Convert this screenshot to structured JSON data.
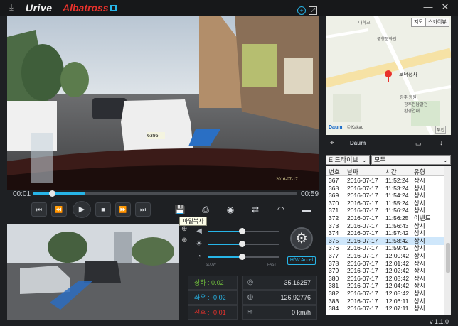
{
  "app": {
    "name_part1": "Urive",
    "name_part2": "Albatross",
    "version": "v 1.1.0"
  },
  "window": {
    "minimize": "—",
    "close": "✕",
    "download": "⤓"
  },
  "video": {
    "main_label": "dashcam-front-view",
    "overlay_icons": [
      "zoom-icon",
      "expand-icon"
    ],
    "sub_label": "dashcam-rear-view",
    "plate_text": "6395",
    "timestamp_overlay": "2016-07-17"
  },
  "player": {
    "time_current": "00:01",
    "time_total": "00:59",
    "progress": 0.04,
    "controls": [
      "first-icon",
      "rewind-icon",
      "play-icon",
      "stop-icon",
      "fast-forward-icon",
      "last-icon"
    ],
    "tools": [
      "save-icon",
      "print-icon",
      "camera-icon",
      "swap-icon",
      "speed-icon",
      "car-icon"
    ],
    "tooltip": "파일복사"
  },
  "adjust": {
    "volume": 0.48,
    "brightness": 0.48,
    "speed": 0.48,
    "slow_label": "SLOW",
    "fast_label": "FAST",
    "hwaccel": "H/W Accel"
  },
  "sensors": {
    "updown_label": "상하 : 0.02",
    "leftright_label": "좌우 : -0.02",
    "frontback_label": "전후 : -0.01",
    "latitude": "35.16257",
    "longitude": "126.92776",
    "speed": "0 km/h"
  },
  "map": {
    "tab_map": "지도",
    "tab_skyview": "스카이뷰",
    "label_univ": "대학교",
    "label_school": "풍향문화관",
    "label_temple": "보덕정사",
    "label_office": "광주 동원",
    "label_env": "광주전남발전\n환경연대",
    "scale": "두럽",
    "attribution": "© Kakao",
    "logo": "Daum",
    "provider": "Daum"
  },
  "list": {
    "drive_select": "E 드라이브",
    "type_select": "모두",
    "columns": [
      "번호",
      "날짜",
      "시간",
      "유형"
    ],
    "rows": [
      [
        "367",
        "2016-07-17",
        "11:52:24",
        "상시"
      ],
      [
        "368",
        "2016-07-17",
        "11:53:24",
        "상시"
      ],
      [
        "369",
        "2016-07-17",
        "11:54:24",
        "상시"
      ],
      [
        "370",
        "2016-07-17",
        "11:55:24",
        "상시"
      ],
      [
        "371",
        "2016-07-17",
        "11:56:24",
        "상시"
      ],
      [
        "372",
        "2016-07-17",
        "11:56:25",
        "이벤트"
      ],
      [
        "373",
        "2016-07-17",
        "11:56:43",
        "상시"
      ],
      [
        "374",
        "2016-07-17",
        "11:57:42",
        "상시"
      ],
      [
        "375",
        "2016-07-17",
        "11:58:42",
        "상시"
      ],
      [
        "376",
        "2016-07-17",
        "11:59:42",
        "상시"
      ],
      [
        "377",
        "2016-07-17",
        "12:00:42",
        "상시"
      ],
      [
        "378",
        "2016-07-17",
        "12:01:42",
        "상시"
      ],
      [
        "379",
        "2016-07-17",
        "12:02:42",
        "상시"
      ],
      [
        "380",
        "2016-07-17",
        "12:03:42",
        "상시"
      ],
      [
        "381",
        "2016-07-17",
        "12:04:42",
        "상시"
      ],
      [
        "382",
        "2016-07-17",
        "12:05:42",
        "상시"
      ],
      [
        "383",
        "2016-07-17",
        "12:06:11",
        "상시"
      ],
      [
        "384",
        "2016-07-17",
        "12:07:11",
        "상시"
      ]
    ],
    "selected_index": 8
  },
  "colors": {
    "accent": "#27b5e8",
    "brand_red": "#e8322c",
    "sensor_green": "#6fbc3c",
    "selected_row": "#cfe7fb"
  }
}
